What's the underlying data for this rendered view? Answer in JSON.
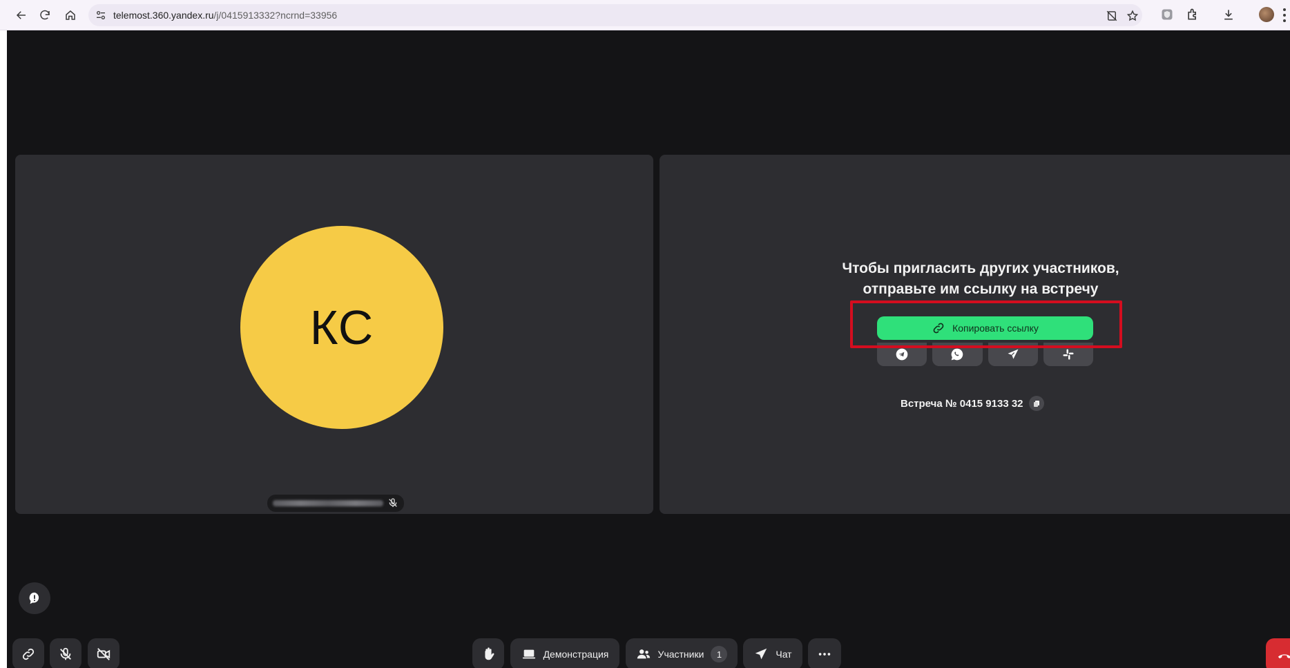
{
  "browser": {
    "url_host": "telemost.360.yandex.ru",
    "url_path": "/j/0415913332?ncrnd=33956"
  },
  "participant": {
    "initials": "КС"
  },
  "invite": {
    "title_line1": "Чтобы пригласить других участников,",
    "title_line2": "отправьте им ссылку на встречу",
    "copy_label": "Копировать ссылку",
    "share_targets": [
      "telegram-icon",
      "whatsapp-icon",
      "send-icon",
      "slack-icon"
    ],
    "meeting_label": "Встреча № 0415 9133 32"
  },
  "controls": {
    "demo_label": "Демонстрация",
    "participants_label": "Участники",
    "participants_count": "1",
    "chat_label": "Чат"
  },
  "colors": {
    "background": "#141416",
    "tile": "#2d2d31",
    "avatar": "#f6cb46",
    "accent_green": "#2fe07a",
    "highlight_red": "#d40d1f",
    "end_call": "#d72c31"
  }
}
